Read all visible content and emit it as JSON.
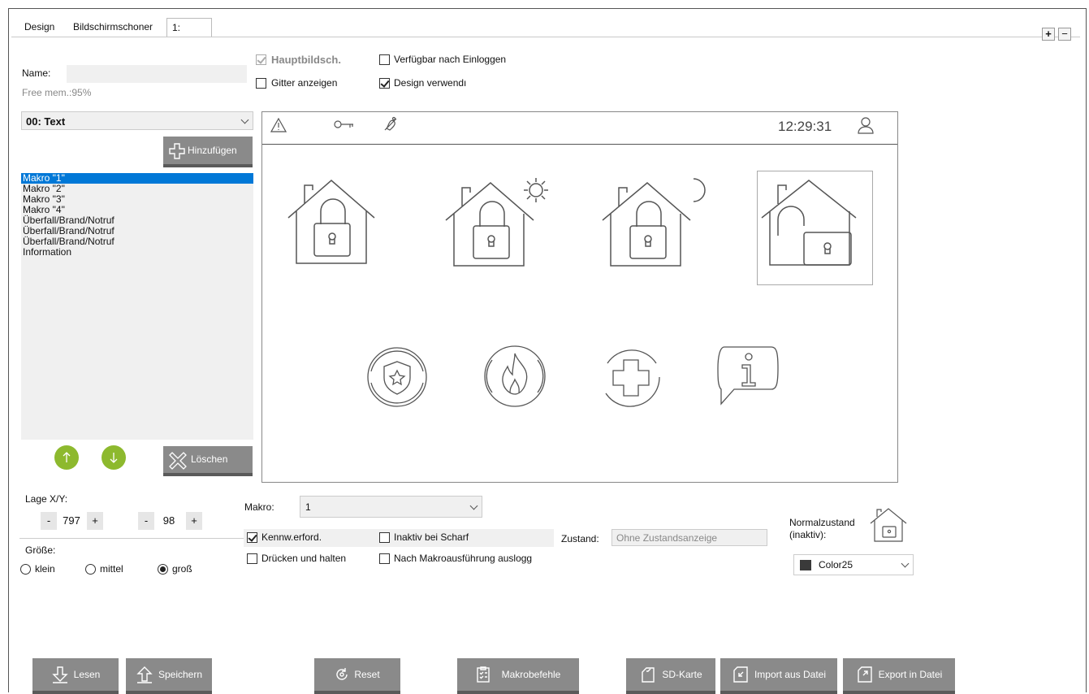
{
  "tabs": [
    {
      "label": "Design"
    },
    {
      "label": "Bildschirmschoner"
    },
    {
      "label": "1:"
    }
  ],
  "tab_controls": {
    "add": "+",
    "remove": "−"
  },
  "left": {
    "name_label": "Name:",
    "name_value": "",
    "free_mem": "Free mem.:95%",
    "type_select": "00: Text",
    "add_button": "Hinzufügen",
    "list_items": [
      "Makro \"1\"",
      "Makro \"2\"",
      "Makro \"3\"",
      "Makro \"4\"",
      "Überfall/Brand/Notruf",
      "Überfall/Brand/Notruf",
      "Überfall/Brand/Notruf",
      "Information"
    ],
    "selected_index": 0,
    "delete_button": "Löschen",
    "position_label": "Lage X/Y:",
    "x_value": "797",
    "y_value": "98",
    "minus": "-",
    "plus": "+",
    "size_label": "Größe:",
    "size_options": [
      "klein",
      "mittel",
      "groß"
    ],
    "size_selected": "groß"
  },
  "options": {
    "hauptbildsch": {
      "label": "Hauptbildsch.",
      "checked": true,
      "disabled": true
    },
    "verfuegbar": {
      "label": "Verfügbar nach Einloggen",
      "checked": false
    },
    "gitter": {
      "label": "Gitter anzeigen",
      "checked": false
    },
    "design": {
      "label": "Design verwendı",
      "checked": true
    }
  },
  "preview": {
    "time": "12:29:31",
    "status_icons": [
      "warning-icon",
      "key-icon",
      "bell-off-icon"
    ],
    "tiles_row1": [
      "house-lock-icon",
      "house-lock-sun-icon",
      "house-lock-moon-icon",
      "house-unlock-icon"
    ],
    "tiles_row2": [
      "police-badge-icon",
      "fire-icon",
      "medical-cross-icon",
      "info-bubble-icon"
    ]
  },
  "macro": {
    "label": "Makro:",
    "value": "1",
    "kennw": {
      "label": "Kennw.erford.",
      "checked": true
    },
    "inaktiv": {
      "label": "Inaktiv bei Scharf",
      "checked": false
    },
    "druecken": {
      "label": "Drücken und halten",
      "checked": false
    },
    "nach": {
      "label": "Nach Makroausführung auslogg",
      "checked": false
    },
    "zustand_label": "Zustand:",
    "zustand_value": "Ohne Zustandsanzeige"
  },
  "normal": {
    "label_line1": "Normalzustand",
    "label_line2": "(inaktiv):",
    "color_value": "Color25",
    "color_swatch": "#3a3a3a"
  },
  "bottom_buttons": [
    {
      "label": "Lesen",
      "icon": "download-icon"
    },
    {
      "label": "Speichern",
      "icon": "upload-icon"
    },
    {
      "label": "Reset",
      "icon": "reset-icon"
    },
    {
      "label": "Makrobefehle",
      "icon": "checklist-icon"
    },
    {
      "label": "SD-Karte",
      "icon": "sd-card-icon"
    },
    {
      "label": "Import aus Datei",
      "icon": "import-icon"
    },
    {
      "label": "Export in Datei",
      "icon": "export-icon"
    }
  ],
  "colors": {
    "accent_green": "#8db92e",
    "selection": "#0078d7",
    "button_gray": "#8a8a8a"
  }
}
